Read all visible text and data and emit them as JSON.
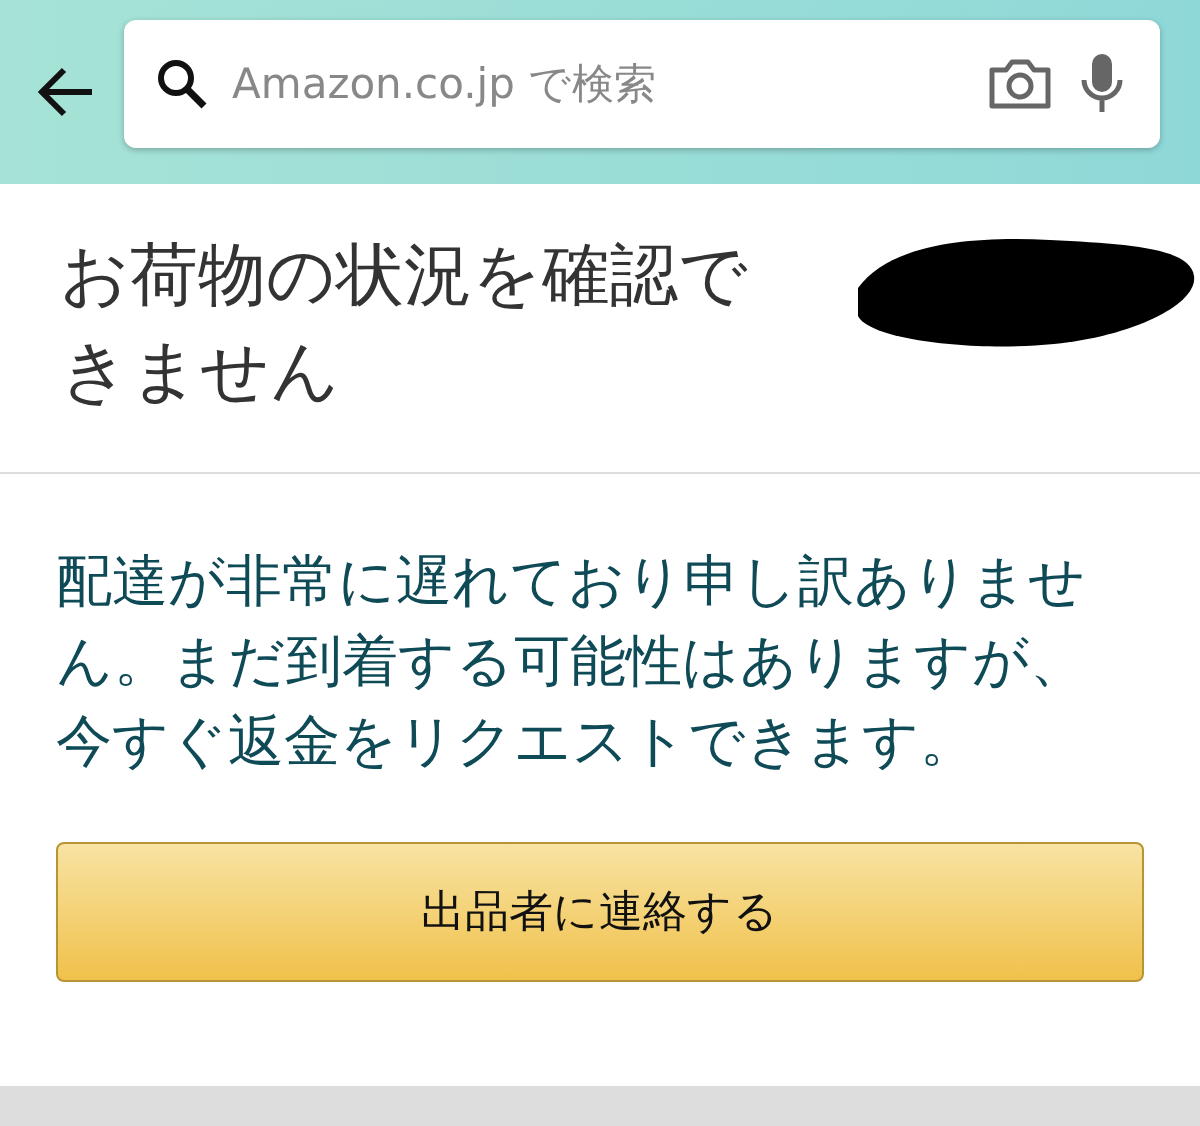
{
  "search": {
    "placeholder": "Amazon.co.jp で検索"
  },
  "title": "お荷物の状況を確認できません",
  "message": "配達が非常に遅れており申し訳ありません。まだ到着する可能性はありますが、今すぐ返金をリクエストできます。",
  "button": "出品者に連絡する"
}
